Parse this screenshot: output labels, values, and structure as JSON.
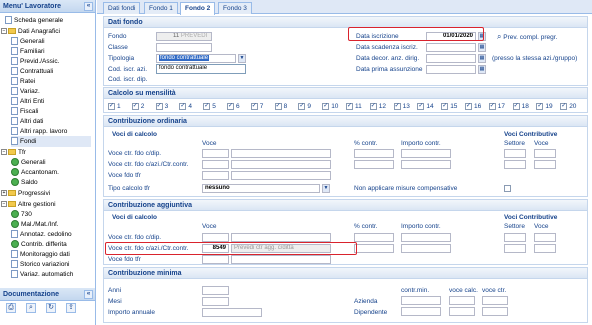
{
  "sidebar": {
    "title": "Menu' Lavoratore",
    "collapse": "«",
    "items": [
      {
        "label": "Scheda generale"
      },
      {
        "label": "Dati Anagrafici"
      },
      {
        "label": "Generali"
      },
      {
        "label": "Familiari"
      },
      {
        "label": "Previd./Assic."
      },
      {
        "label": "Contrattuali"
      },
      {
        "label": "Ratei"
      },
      {
        "label": "Variaz."
      },
      {
        "label": "Altri Enti"
      },
      {
        "label": "Fiscali"
      },
      {
        "label": "Altri dati"
      },
      {
        "label": "Altri rapp. lavoro"
      },
      {
        "label": "Fondi"
      },
      {
        "label": "Tfr"
      },
      {
        "label": "Generali"
      },
      {
        "label": "Accantonam."
      },
      {
        "label": "Saldo"
      },
      {
        "label": "Progressivi"
      },
      {
        "label": "Altre gestioni"
      },
      {
        "label": "730"
      },
      {
        "label": "Mal./Mat./Inf."
      },
      {
        "label": "Annotaz. cedolino"
      },
      {
        "label": "Contrib. differita"
      },
      {
        "label": "Monitoraggio dati"
      },
      {
        "label": "Storico variazioni"
      },
      {
        "label": "Variaz. automatich"
      }
    ],
    "doc_title": "Documentazione"
  },
  "tabs": [
    "Dati fondi",
    "Fondo 1",
    "Fondo 2",
    "Fondo 3"
  ],
  "dati_fondo": {
    "title": "Dati fondo",
    "fondo_label": "Fondo",
    "fondo_code": "11",
    "fondo_name": "PREVEDI",
    "classe_label": "Classe",
    "tipologia_label": "Tipologia",
    "tipologia_value": "fondo contrattuale",
    "tipologia_option": "fondo contrattuale",
    "cod_iscr_azi_label": "Cod. iscr. azi.",
    "cod_iscr_dip_label": "Cod. iscr. dip.",
    "data_iscrizione_label": "Data iscrizione",
    "data_iscrizione_value": "01/01/2020",
    "data_scadenza_label": "Data scadenza iscriz.",
    "data_decor_label": "Data decor. anz. dirig.",
    "data_prima_label": "Data prima assunzione",
    "prev_compl_label": "Prev. compl. pregr.",
    "presso_label": "(presso la stessa azi./gruppo)"
  },
  "calcolo": {
    "title": "Calcolo su mensilità",
    "months": [
      "1",
      "2",
      "3",
      "4",
      "5",
      "6",
      "7",
      "8",
      "9",
      "10",
      "11",
      "12",
      "13",
      "14",
      "15",
      "16",
      "17",
      "18",
      "19",
      "20"
    ]
  },
  "ordinaria": {
    "title": "Contribuzione ordinaria",
    "voci_calcolo": "Voci di calcolo",
    "voce_h": "Voce",
    "contr_h": "% contr.",
    "importo_h": "Importo contr.",
    "voci_contrib": "Voci Contributive",
    "settore_h": "Settore",
    "voce2_h": "Voce",
    "rows": [
      "Voce ctr. fdo c/dip.",
      "Voce ctr. fdo c/azi./Ctr.contr.",
      "Voce fdo tfr"
    ],
    "tipo_label": "Tipo calcolo tfr",
    "tipo_value": "nessuno",
    "non_applicare": "Non applicare misure compensative"
  },
  "aggiuntiva": {
    "title": "Contribuzione aggiuntiva",
    "voci_calcolo": "Voci di calcolo",
    "voce_h": "Voce",
    "contr_h": "% contr.",
    "importo_h": "Importo contr.",
    "voci_contrib": "Voci Contributive",
    "settore_h": "Settore",
    "voce2_h": "Voce",
    "rows": [
      "Voce ctr. fdo c/dip.",
      "Voce ctr. fdo c/azi./Ctr.contr.",
      "Voce fdo tfr"
    ],
    "azi_code": "8549",
    "azi_desc": "Prevedi ctr agg. c/ditta"
  },
  "minima": {
    "title": "Contribuzione minima",
    "anni": "Anni",
    "mesi": "Mesi",
    "importo_annuale": "Importo annuale",
    "contr_min": "contr.min.",
    "voce_calc": "voce calc.",
    "voce_ctr": "voce ctr.",
    "azienda": "Azienda",
    "dipendente": "Dipendente"
  },
  "colors": {
    "accent": "#15428b",
    "border": "#99bbe8",
    "highlight": "#d9232d"
  }
}
